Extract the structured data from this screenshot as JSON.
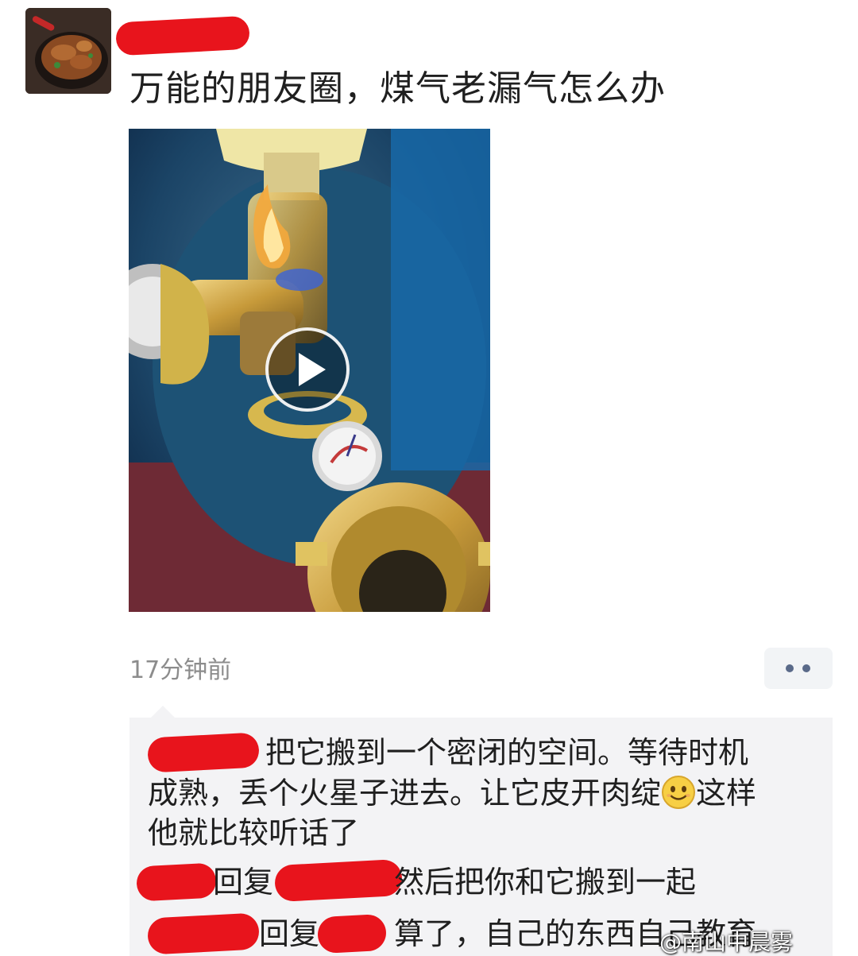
{
  "post": {
    "text": "万能的朋友圈，煤气老漏气怎么办",
    "timestamp": "17分钟前"
  },
  "comments": {
    "line1": "把它搬到一个密闭的空间。等待时机",
    "line2a": "成熟，丢个火星子进去。让它皮开肉绽",
    "line2b": "这样",
    "line3": "他就比较听话了",
    "reply1_word": "回复",
    "reply1_text": "然后把你和它搬到一起",
    "reply2_word": "回复",
    "reply2_text": "算了，自己的东西自己教育"
  },
  "watermark": "@南山中晨雾",
  "icons": {
    "play": "play-icon",
    "more": "more-dots-icon",
    "emoji": "smile-emoji-icon"
  },
  "colors": {
    "redaction": "#e8141c",
    "timestamp": "#8c8c8c",
    "comment_bg": "#f3f3f5",
    "more_dots": "#5a6a89"
  }
}
